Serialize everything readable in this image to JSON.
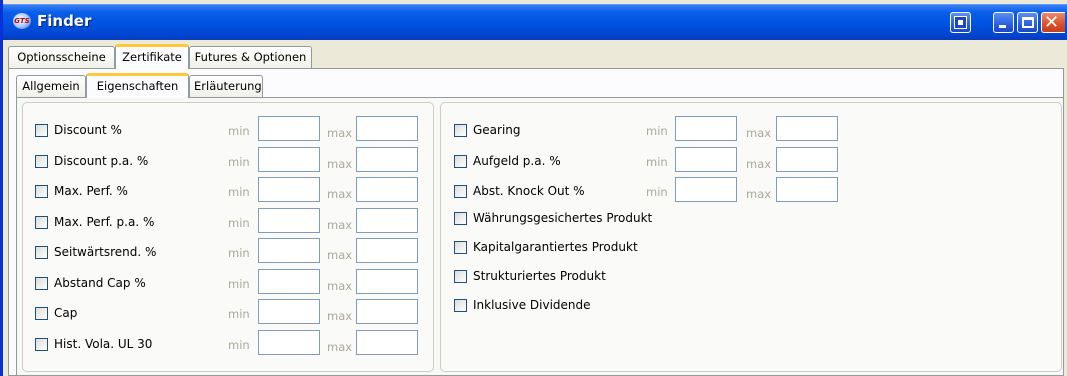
{
  "window": {
    "title": "Finder",
    "app_icon_text": "GTS"
  },
  "tabs_top": [
    {
      "label": "Optionsscheine",
      "active": false
    },
    {
      "label": "Zertifikate",
      "active": true
    },
    {
      "label": "Futures & Optionen",
      "active": false
    }
  ],
  "tabs_sub": [
    {
      "label": "Allgemein",
      "active": false
    },
    {
      "label": "Eigenschaften",
      "active": true
    },
    {
      "label": "Erläuterung",
      "active": false
    }
  ],
  "range_labels": {
    "min": "min",
    "max": "max"
  },
  "left_filters": [
    {
      "label": "Discount %",
      "checked": false,
      "min": "",
      "max": ""
    },
    {
      "label": "Discount p.a. %",
      "checked": false,
      "min": "",
      "max": ""
    },
    {
      "label": "Max. Perf. %",
      "checked": false,
      "min": "",
      "max": ""
    },
    {
      "label": "Max. Perf. p.a. %",
      "checked": false,
      "min": "",
      "max": ""
    },
    {
      "label": "Seitwärtsrend. %",
      "checked": false,
      "min": "",
      "max": ""
    },
    {
      "label": "Abstand Cap %",
      "checked": false,
      "min": "",
      "max": ""
    },
    {
      "label": "Cap",
      "checked": false,
      "min": "",
      "max": ""
    },
    {
      "label": "Hist. Vola. UL 30",
      "checked": false,
      "min": "",
      "max": ""
    }
  ],
  "right_filters": [
    {
      "label": "Gearing",
      "checked": false,
      "min": "",
      "max": ""
    },
    {
      "label": "Aufgeld p.a. %",
      "checked": false,
      "min": "",
      "max": ""
    },
    {
      "label": "Abst. Knock Out %",
      "checked": false,
      "min": "",
      "max": ""
    }
  ],
  "right_checkboxes": [
    {
      "label": "Währungsgesichertes Produkt",
      "checked": false
    },
    {
      "label": "Kapitalgarantiertes Produkt",
      "checked": false
    },
    {
      "label": "Strukturiertes Produkt",
      "checked": false
    },
    {
      "label": "Inklusive Dividende",
      "checked": false
    }
  ]
}
